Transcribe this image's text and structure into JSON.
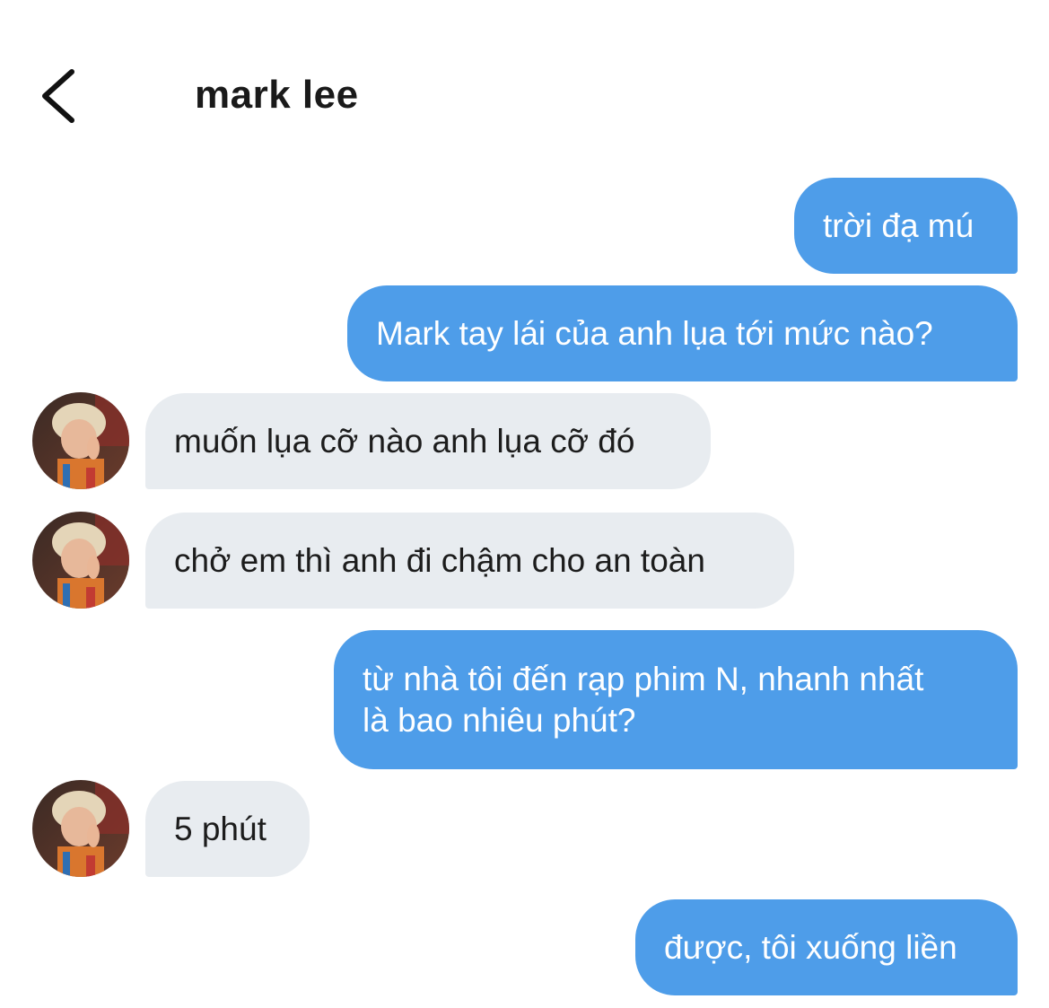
{
  "header": {
    "title": "mark lee",
    "back_icon": "chevron-left-icon"
  },
  "colors": {
    "outgoing_bubble": "#4e9de9",
    "incoming_bubble": "#e8ecf0",
    "outgoing_text": "#ffffff",
    "incoming_text": "#1c1c1c"
  },
  "messages": [
    {
      "direction": "outgoing",
      "text": "trời đạ mú"
    },
    {
      "direction": "outgoing",
      "text": "Mark tay lái của anh lụa tới mức nào?"
    },
    {
      "direction": "incoming",
      "text": "muốn lụa cỡ nào anh lụa cỡ đó"
    },
    {
      "direction": "incoming",
      "text": "chở em thì anh đi chậm cho an toàn"
    },
    {
      "direction": "outgoing",
      "text": "từ nhà tôi đến rạp phim N, nhanh nhất là bao nhiêu phút?"
    },
    {
      "direction": "incoming",
      "text": "5 phút"
    },
    {
      "direction": "outgoing",
      "text": "được, tôi xuống liền"
    }
  ]
}
